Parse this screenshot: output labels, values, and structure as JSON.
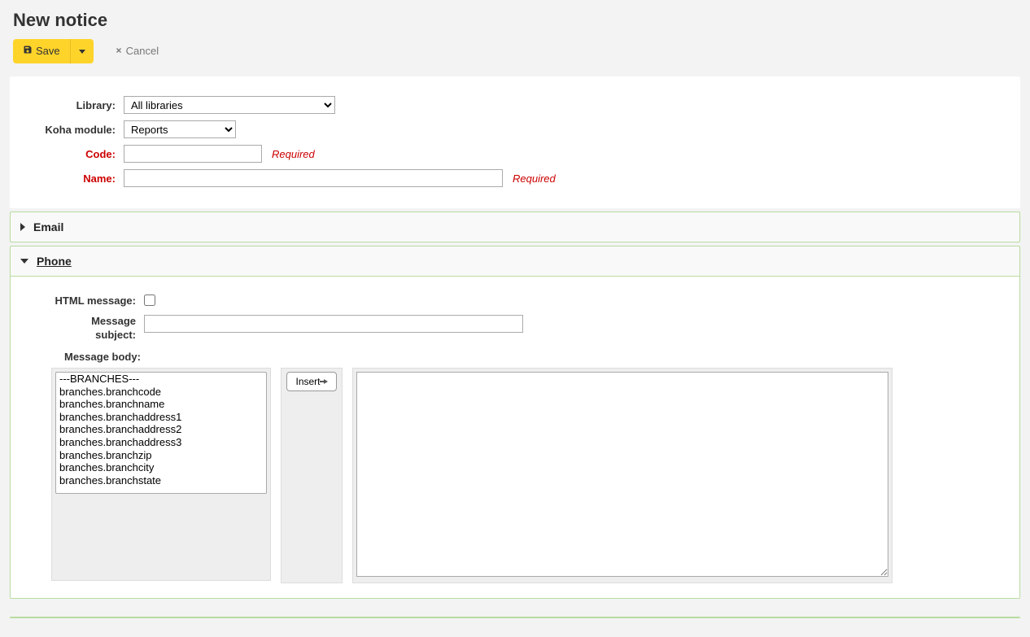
{
  "title": "New notice",
  "toolbar": {
    "save_label": "Save",
    "cancel_label": "Cancel"
  },
  "form": {
    "library_label": "Library:",
    "library_value": "All libraries",
    "module_label": "Koha module:",
    "module_value": "Reports",
    "code_label": "Code:",
    "code_value": "",
    "name_label": "Name:",
    "name_value": "",
    "required_hint": "Required"
  },
  "sections": {
    "email_label": "Email",
    "phone_label": "Phone"
  },
  "phone": {
    "html_label": "HTML message:",
    "html_checked": false,
    "subject_label": "Message subject:",
    "subject_value": "",
    "body_label": "Message body:",
    "insert_label": "Insert",
    "field_list": [
      "---BRANCHES---",
      "branches.branchcode",
      "branches.branchname",
      "branches.branchaddress1",
      "branches.branchaddress2",
      "branches.branchaddress3",
      "branches.branchzip",
      "branches.branchcity",
      "branches.branchstate"
    ],
    "body_value": ""
  }
}
